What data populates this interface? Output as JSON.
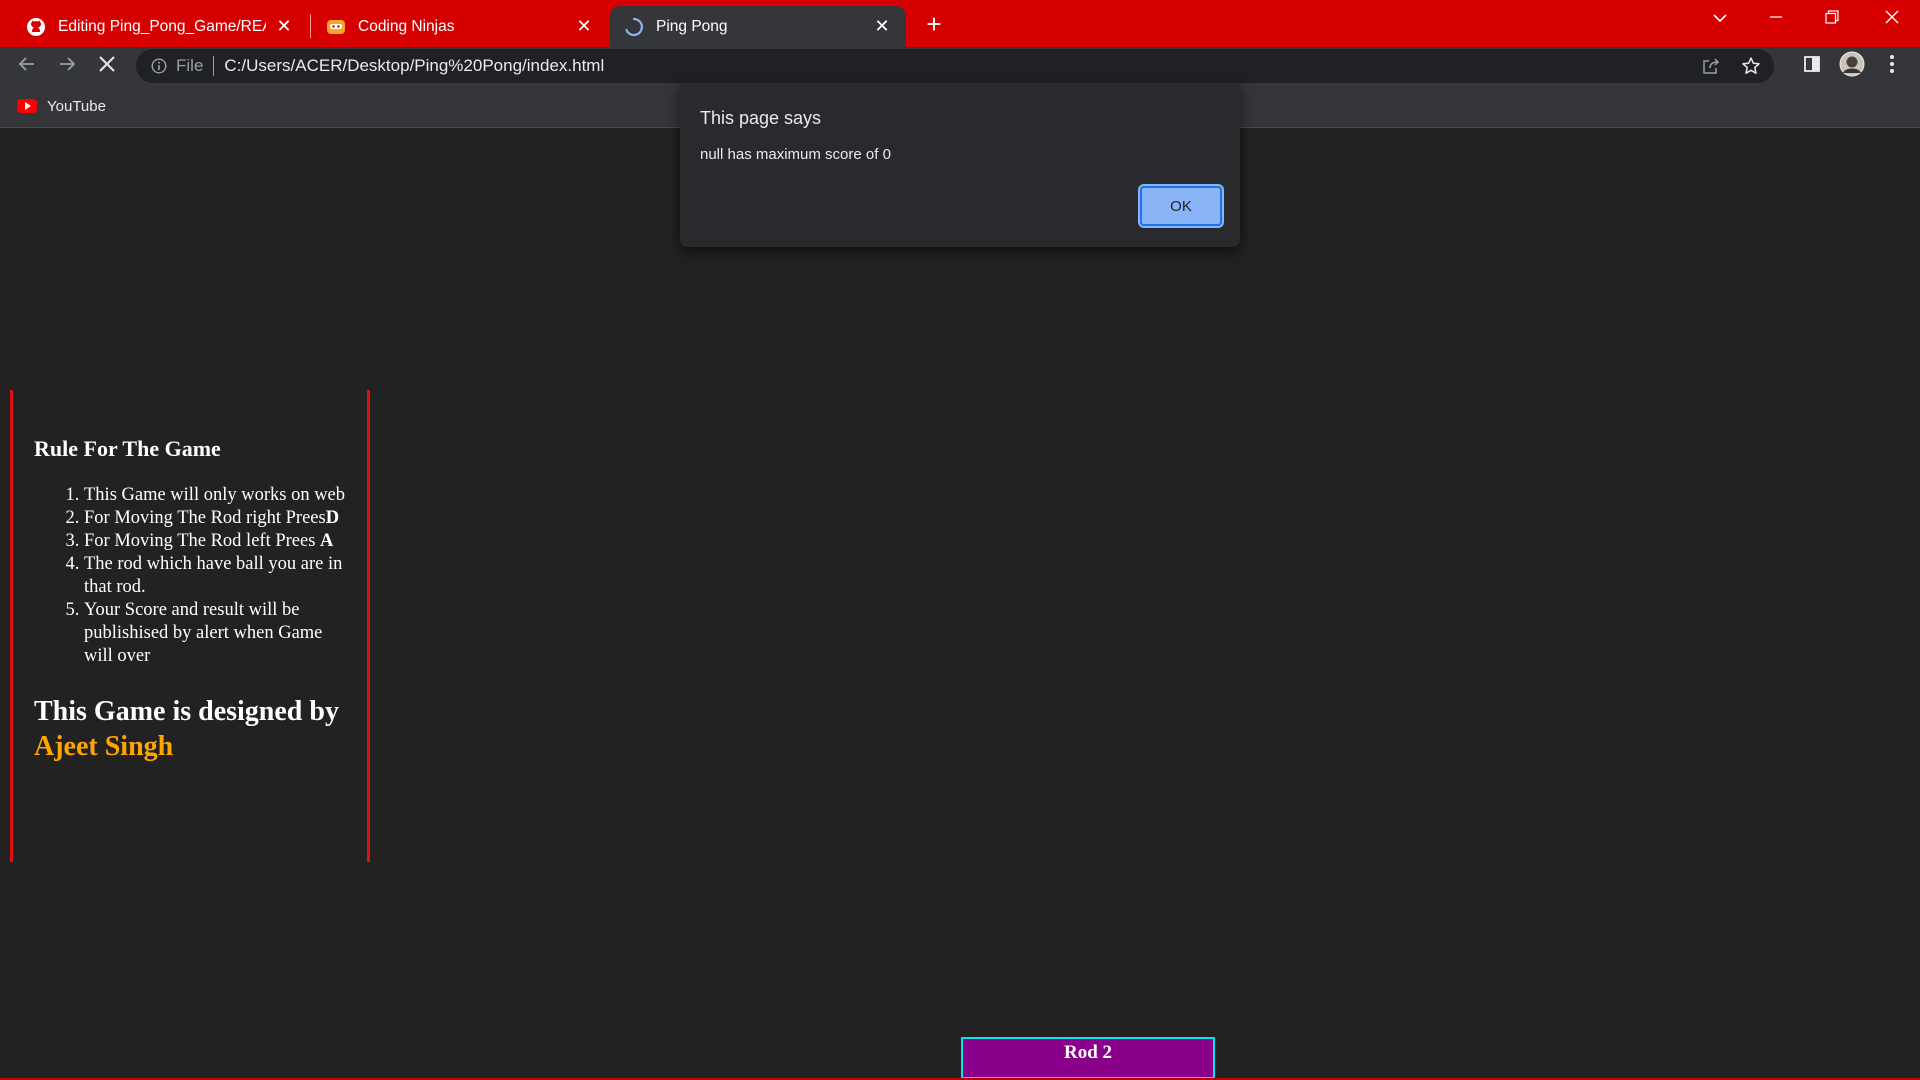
{
  "browser": {
    "tabs": [
      {
        "title": "Editing Ping_Pong_Game/README",
        "icon": "github-icon",
        "active": false
      },
      {
        "title": "Coding Ninjas",
        "icon": "coding-ninjas-icon",
        "active": false
      },
      {
        "title": "Ping Pong",
        "icon": "loading-spinner-icon",
        "active": true
      }
    ],
    "tab_close": "✕",
    "new_tab": "+",
    "address": {
      "scheme_label": "File",
      "url": "C:/Users/ACER/Desktop/Ping%20Pong/index.html"
    },
    "bookmarks": [
      {
        "label": "YouTube",
        "icon": "youtube-icon"
      }
    ],
    "colors": {
      "tabstrip": "#d60000",
      "toolbar": "#35363a",
      "page_bg": "#222222"
    }
  },
  "page": {
    "rules_title": "Rule For The Game",
    "rules": [
      "This Game will only works on web",
      "For Moving The Rod right Prees",
      "For Moving The Rod left Prees ",
      "The rod which have ball you are in that rod.",
      "Your Score and result will be publishised by alert when Game will over"
    ],
    "rule_keys": {
      "right": "D",
      "left": "A"
    },
    "designed_by_prefix": "This Game is designed by ",
    "designer": "Ajeet Singh",
    "rod_label": "Rod 2",
    "colors": {
      "border_accent": "#e01010",
      "designer": "#ffa500",
      "rod_fill": "#8b008b",
      "rod_border": "#00e5e5"
    }
  },
  "alert": {
    "title": "This page says",
    "message": "null has maximum score of 0",
    "ok_label": "OK"
  }
}
